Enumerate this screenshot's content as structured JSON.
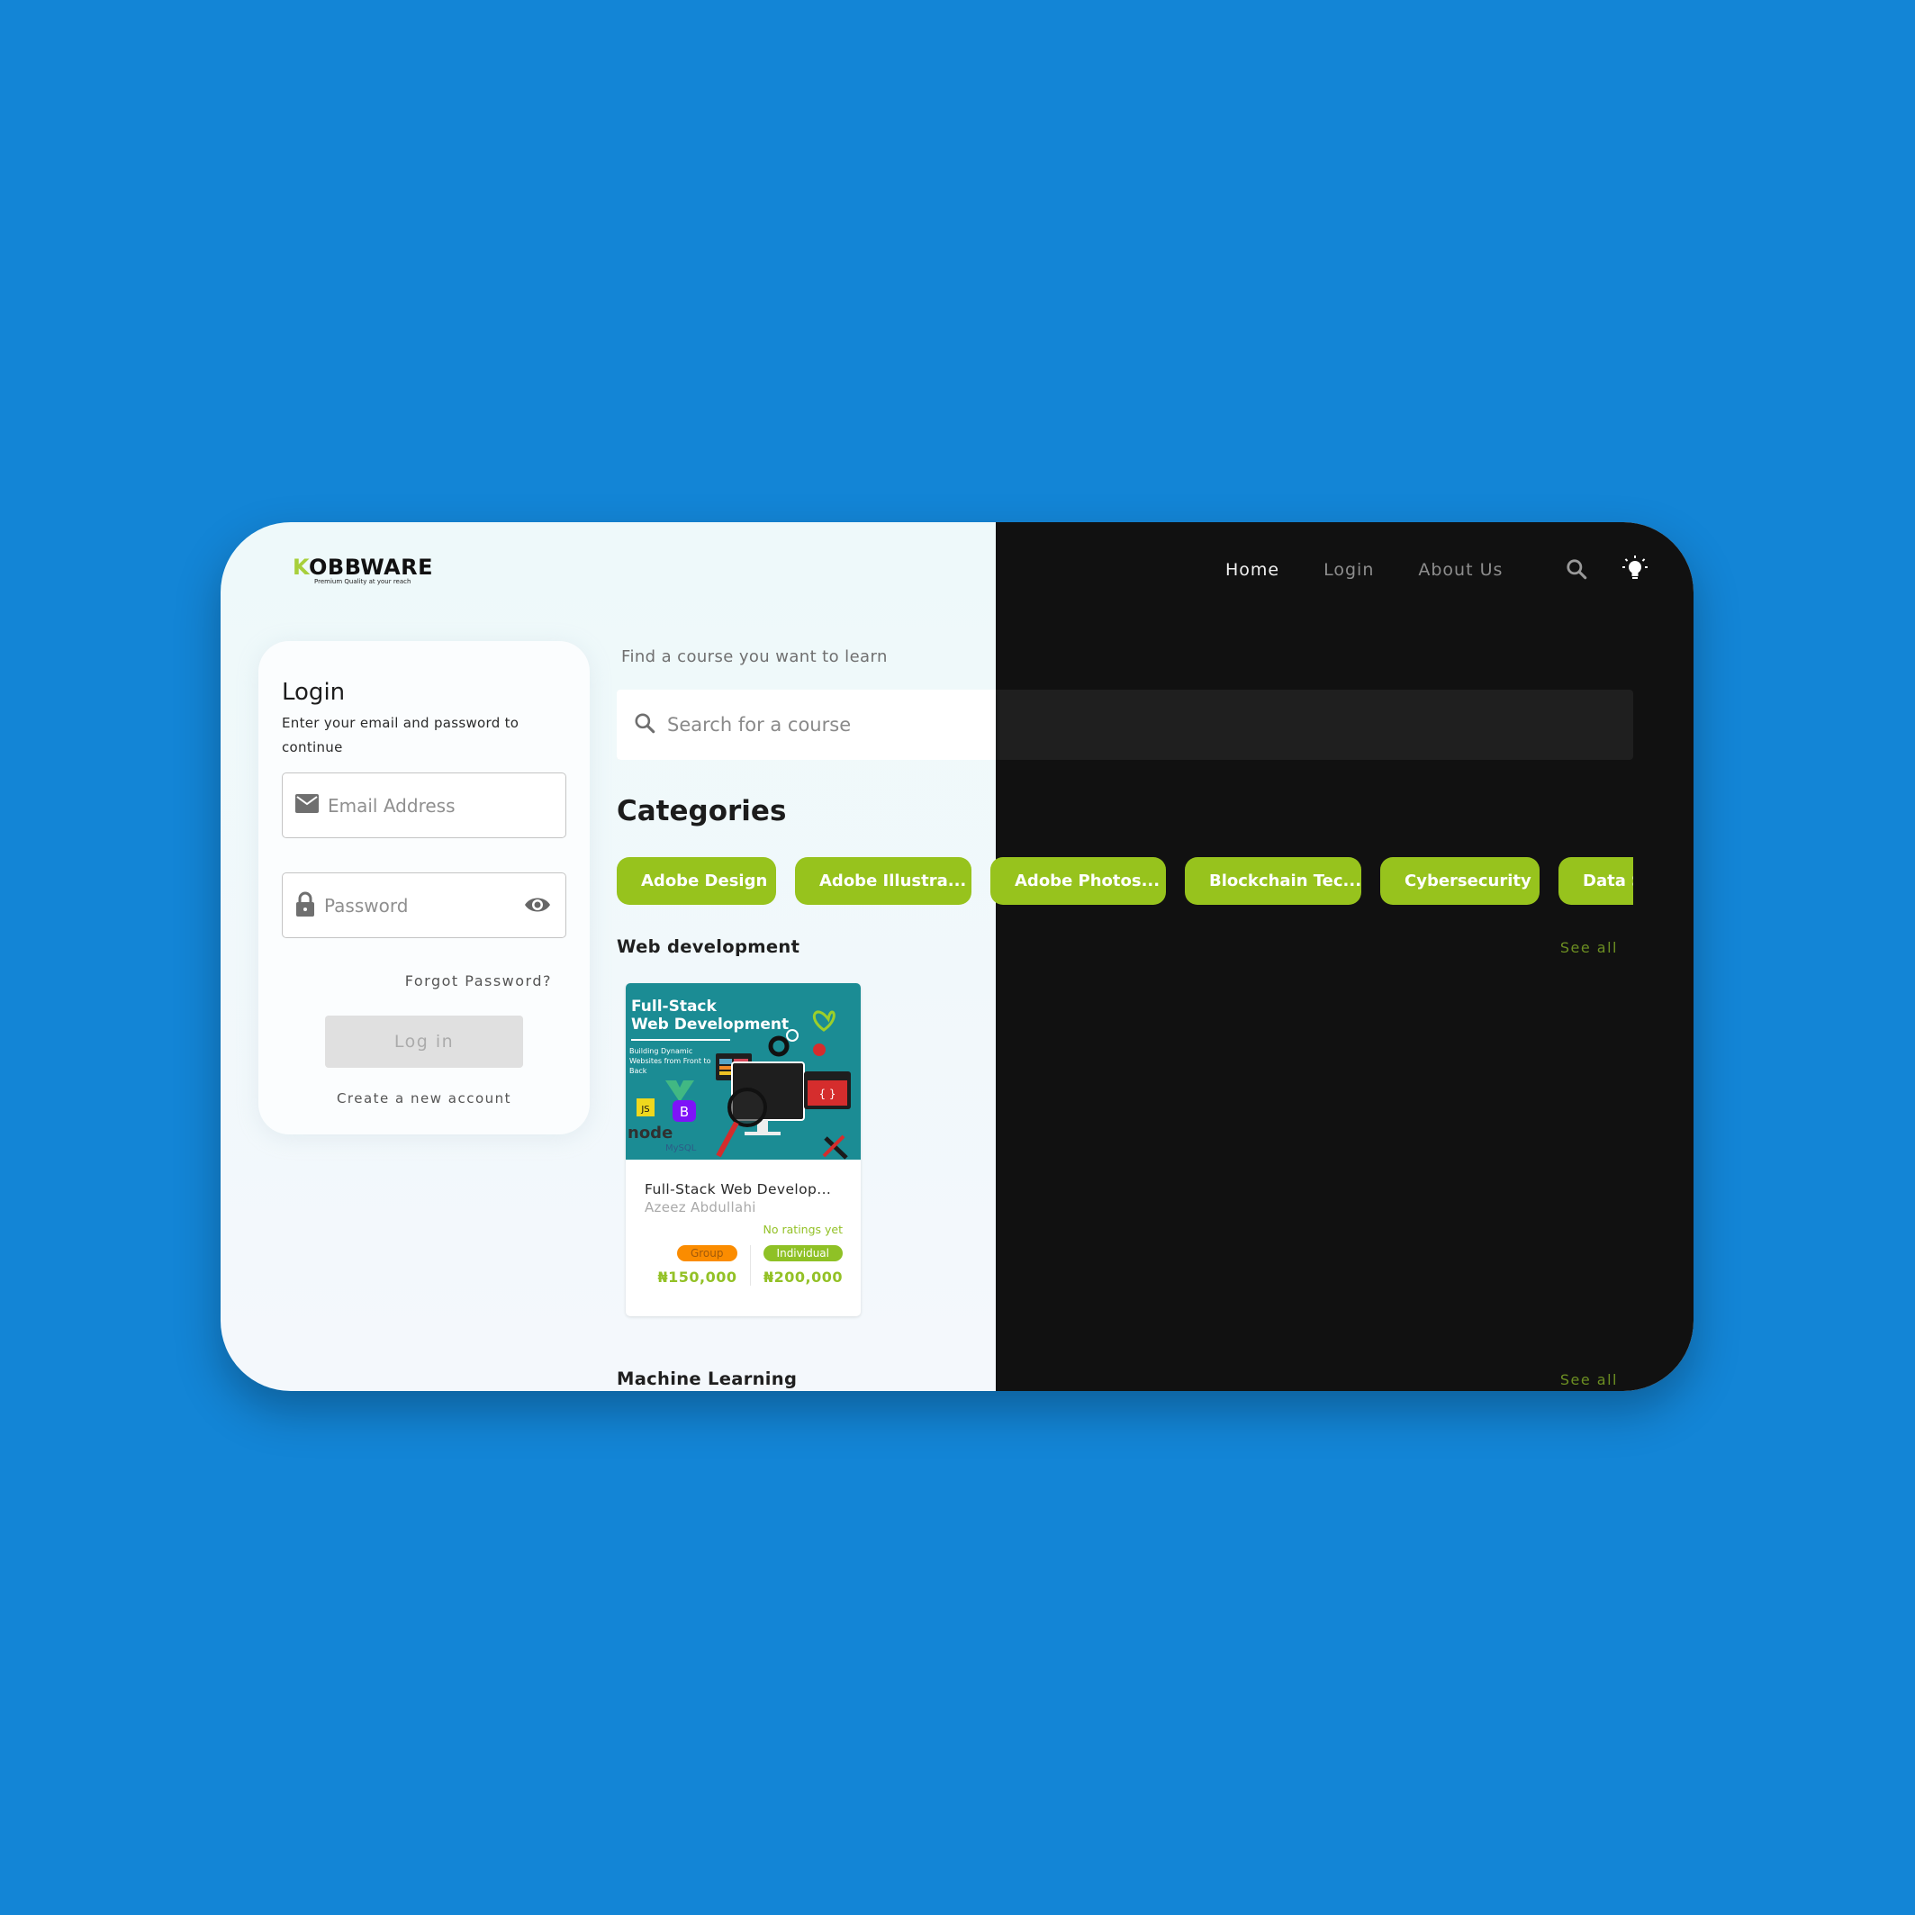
{
  "brand": {
    "name_first_letter": "K",
    "name_rest": "OBBWARE",
    "tagline": "Premium Quality at your reach"
  },
  "nav": {
    "items": [
      {
        "label": "Home",
        "active": true
      },
      {
        "label": "Login",
        "active": false
      },
      {
        "label": "About Us",
        "active": false
      }
    ],
    "icons": [
      "search-icon",
      "lightbulb-icon"
    ]
  },
  "login": {
    "title": "Login",
    "subtitle": "Enter your email and password to continue",
    "email_placeholder": "Email Address",
    "password_placeholder": "Password",
    "forgot_label": "Forgot Password?",
    "submit_label": "Log in",
    "create_label": "Create a new account"
  },
  "search": {
    "label": "Find a course you want to learn",
    "placeholder": "Search for a course"
  },
  "categories": {
    "title": "Categories",
    "items": [
      "Adobe Design",
      "Adobe Illustra...",
      "Adobe Photos...",
      "Blockchain Tec...",
      "Cybersecurity",
      "Data S"
    ]
  },
  "sections": [
    {
      "title": "Web development",
      "see_all": "See all",
      "courses": [
        {
          "thumb_title_line1": "Full-Stack",
          "thumb_title_line2": "Web Development",
          "thumb_subtitle": "Building Dynamic Websites from Front to Back",
          "title": "Full-Stack Web Develop...",
          "author": "Azeez Abdullahi",
          "ratings": "No ratings yet",
          "group_label": "Group",
          "group_price": "₦150,000",
          "individual_label": "Individual",
          "individual_price": "₦200,000"
        }
      ]
    },
    {
      "title": "Machine Learning",
      "see_all": "See all"
    }
  ],
  "colors": {
    "background": "#1385d6",
    "accent_green": "#97c31d",
    "orange": "#fb8c00",
    "dark_panel": "#111111"
  }
}
